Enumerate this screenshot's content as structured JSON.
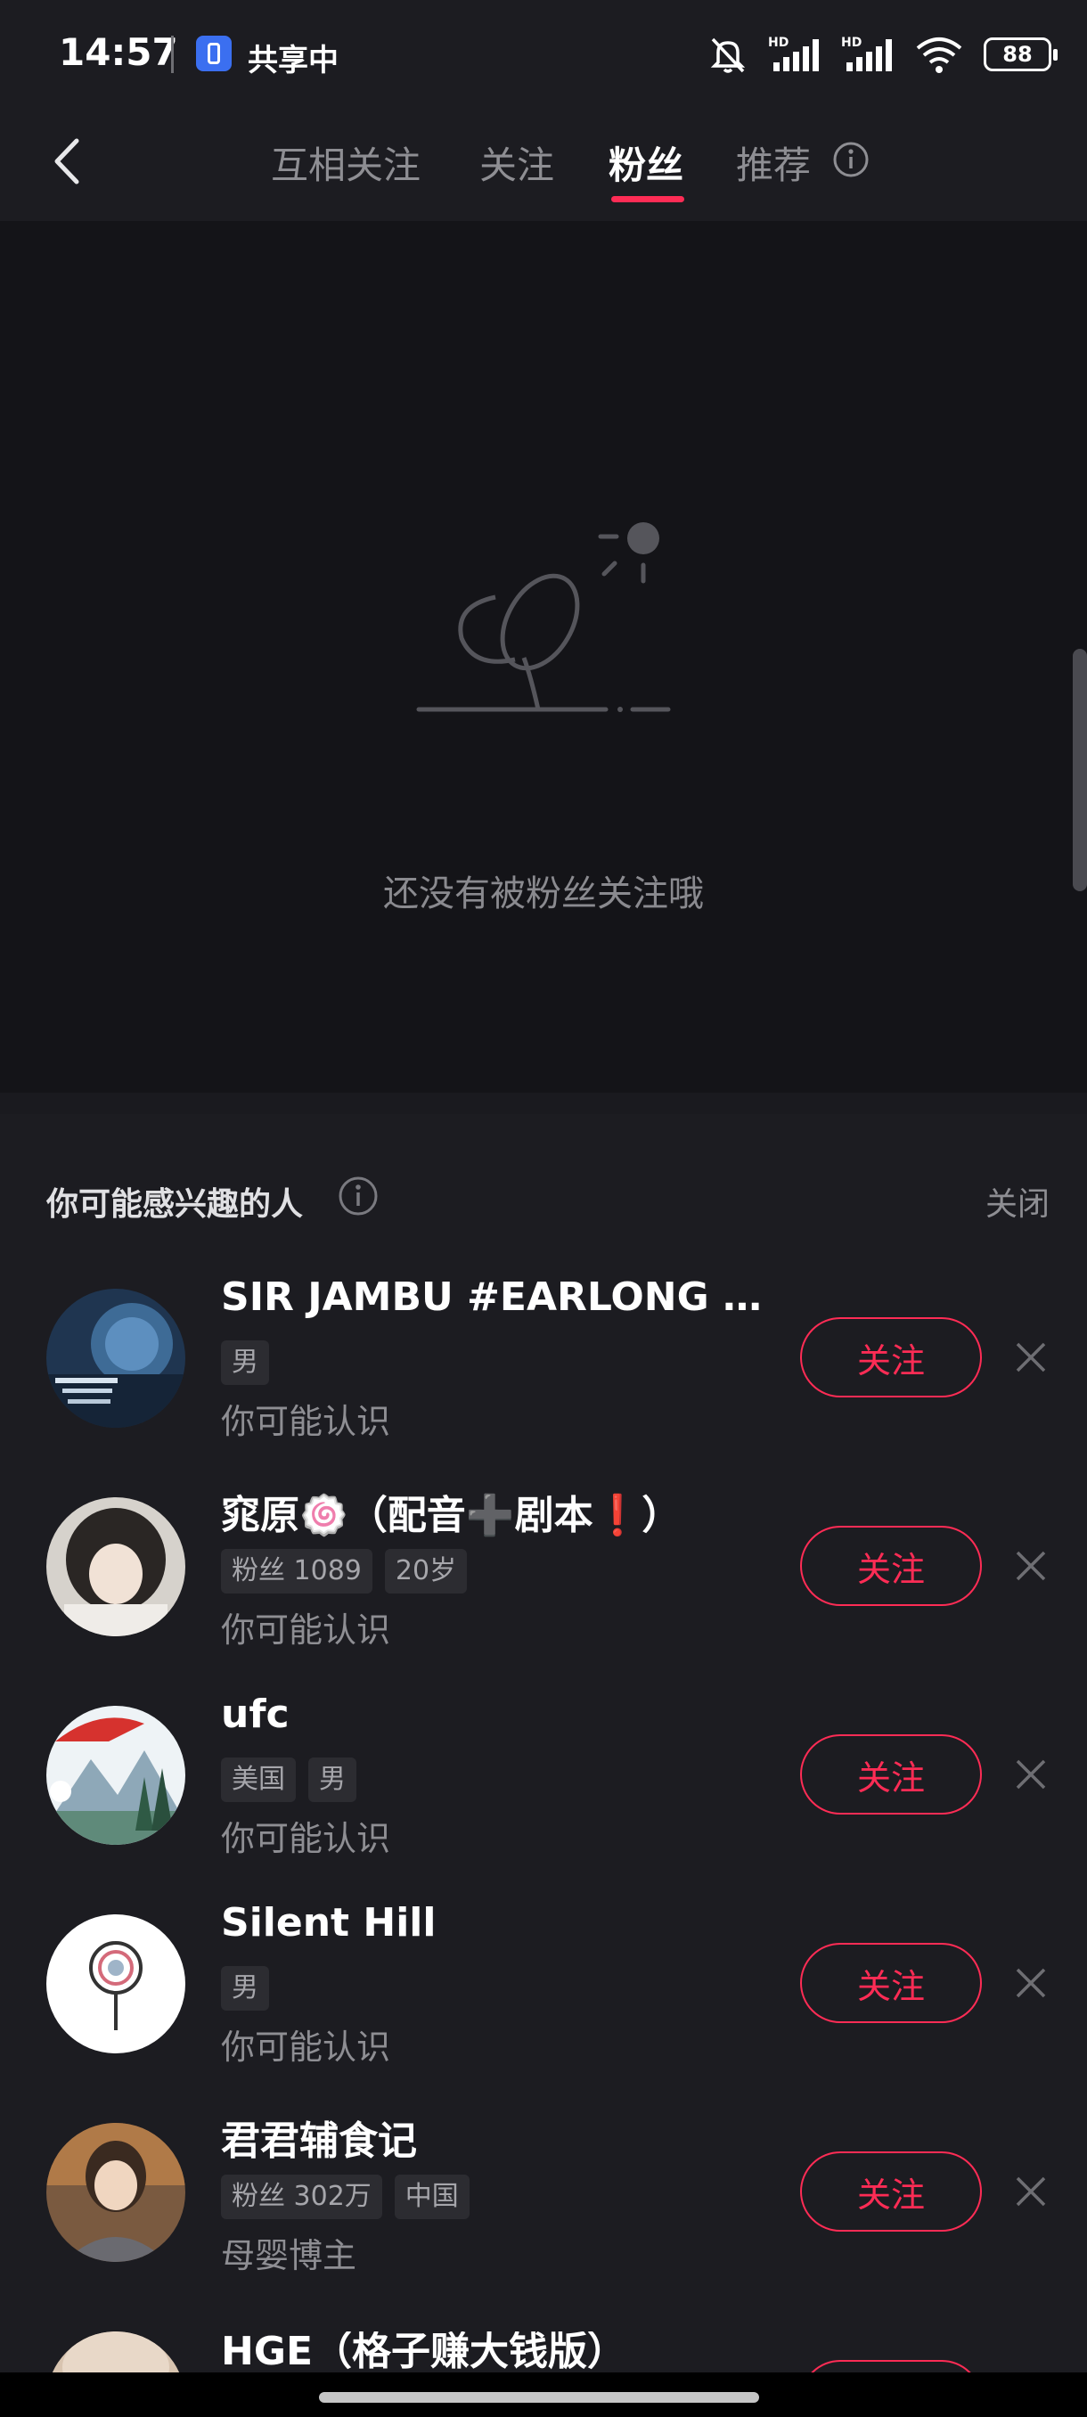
{
  "status_bar": {
    "time": "14:57",
    "sharing_label": "共享中",
    "battery": "88",
    "icons": [
      "bell-off-icon",
      "signal-hd-icon",
      "signal-hd-icon",
      "wifi-icon",
      "battery-icon"
    ]
  },
  "nav": {
    "tabs": [
      {
        "label": "互相关注"
      },
      {
        "label": "关注"
      },
      {
        "label": "粉丝"
      },
      {
        "label": "推荐"
      }
    ],
    "active_tab": "粉丝"
  },
  "empty_state": {
    "message": "还没有被粉丝关注哦"
  },
  "suggestions": {
    "title": "你可能感兴趣的人",
    "close_label": "关闭",
    "follow_label": "关注",
    "users": [
      {
        "name": "SIR JAMBU #EARLONG M...",
        "tags": [
          "男"
        ],
        "reason": "你可能认识"
      },
      {
        "name": "窕原🍥（配音➕剧本❗）",
        "tags": [
          "粉丝 1089",
          "20岁"
        ],
        "reason": "你可能认识"
      },
      {
        "name": "ufc",
        "tags": [
          "美国",
          "男"
        ],
        "reason": "你可能认识"
      },
      {
        "name": "Silent Hill",
        "tags": [
          "男"
        ],
        "reason": "你可能认识"
      },
      {
        "name": "君君辅食记",
        "tags": [
          "粉丝 302万",
          "中国"
        ],
        "reason": "母婴博主"
      },
      {
        "name": "HGE（格子赚大钱版）",
        "tags": [],
        "reason": ""
      }
    ]
  },
  "colors": {
    "accent": "#fe2c55",
    "background": "#1c1c21",
    "empty_background": "#141418"
  }
}
